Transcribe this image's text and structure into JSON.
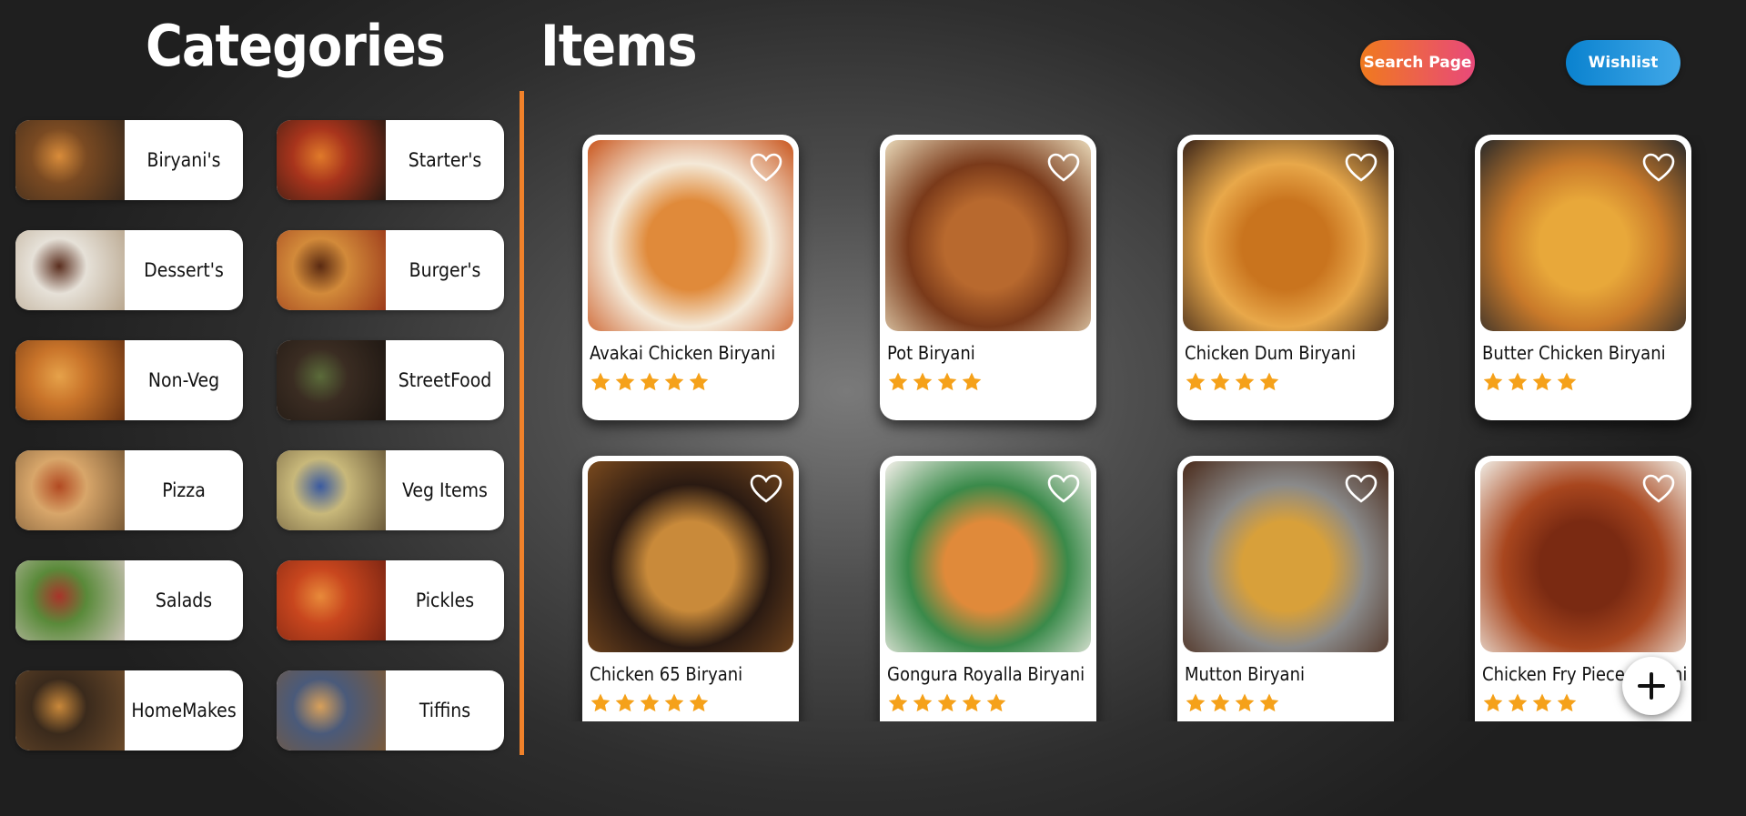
{
  "header": {
    "categories_title": "Categories",
    "items_title": "Items",
    "search_button": "Search Page",
    "wishlist_button": "Wishlist"
  },
  "categories": [
    {
      "label": "Biryani's",
      "colors": [
        "#7a4a22",
        "#d98c3a",
        "#3b2a1c"
      ]
    },
    {
      "label": "Starter's",
      "colors": [
        "#a8341c",
        "#e07a2a",
        "#2a1a12"
      ]
    },
    {
      "label": "Dessert's",
      "colors": [
        "#e6e1d8",
        "#5a2e1e",
        "#b9a78f"
      ]
    },
    {
      "label": "Burger's",
      "colors": [
        "#d28a3a",
        "#5a2a12",
        "#9c3a1a"
      ]
    },
    {
      "label": "Non-Veg",
      "colors": [
        "#c9742a",
        "#e6a24a",
        "#6b3412"
      ]
    },
    {
      "label": "StreetFood",
      "colors": [
        "#3a2c22",
        "#5b6b3a",
        "#1e1712"
      ]
    },
    {
      "label": "Pizza",
      "colors": [
        "#d8a66a",
        "#b24a22",
        "#7a5a36"
      ]
    },
    {
      "label": "Veg Items",
      "colors": [
        "#c8b87a",
        "#3a5aa0",
        "#6b5a3a"
      ]
    },
    {
      "label": "Salads",
      "colors": [
        "#5a8a3a",
        "#a8342a",
        "#c9c2b4"
      ]
    },
    {
      "label": "Pickles",
      "colors": [
        "#c8461e",
        "#e88a3a",
        "#7a2412"
      ]
    },
    {
      "label": "HomeMakes",
      "colors": [
        "#3a2a1c",
        "#c9883a",
        "#6b4a2a"
      ]
    },
    {
      "label": "Tiffins",
      "colors": [
        "#4a5a7a",
        "#d8a05a",
        "#7a5a3a"
      ]
    }
  ],
  "items": [
    {
      "name": "Avakai Chicken Biryani",
      "rating": 5,
      "colors": [
        "#e08a3a",
        "#c9561e",
        "#f4e9d8"
      ]
    },
    {
      "name": "Pot Biryani",
      "rating": 4,
      "colors": [
        "#b8692e",
        "#e8d8b8",
        "#7a3a1a"
      ]
    },
    {
      "name": "Chicken Dum Biryani",
      "rating": 4,
      "colors": [
        "#c9741e",
        "#3a2418",
        "#e8a84a"
      ]
    },
    {
      "name": "Butter Chicken Biryani",
      "rating": 4,
      "colors": [
        "#e8a83a",
        "#2a2a2a",
        "#c97a2a"
      ]
    },
    {
      "name": "Chicken 65 Biryani",
      "rating": 5,
      "colors": [
        "#c98a3a",
        "#7a4a1e",
        "#2a1a12"
      ]
    },
    {
      "name": "Gongura Royalla Biryani",
      "rating": 5,
      "colors": [
        "#e08a3a",
        "#f4f0ea",
        "#3a8a4a"
      ]
    },
    {
      "name": "Mutton Biryani",
      "rating": 4,
      "colors": [
        "#d8a03a",
        "#4a2a1a",
        "#8a8a8a"
      ]
    },
    {
      "name": "Chicken Fry Piece Biryani",
      "rating": 4,
      "colors": [
        "#7a2a12",
        "#f0ece4",
        "#a8461e"
      ]
    }
  ],
  "icons": {
    "heart": "heart-icon",
    "star": "star-icon",
    "add": "plus-icon"
  },
  "theme": {
    "accent_orange": "#f0812a",
    "star_color": "#f5a11a",
    "search_gradient": [
      "#f07a1e",
      "#e8497a"
    ],
    "wishlist_gradient": [
      "#0a82cf",
      "#41a8e8"
    ]
  }
}
